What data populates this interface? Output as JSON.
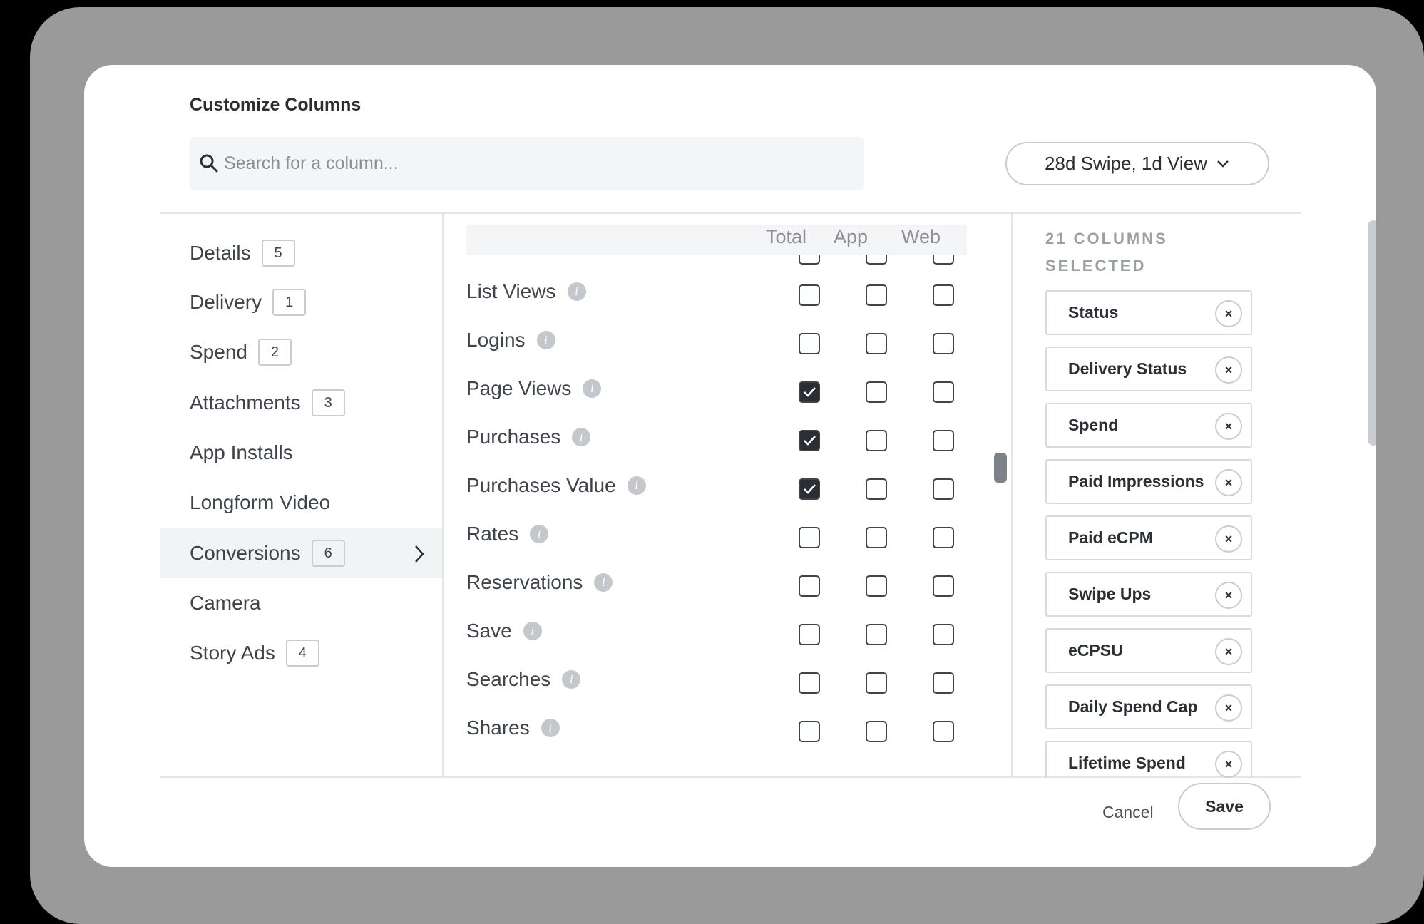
{
  "modal": {
    "title": "Customize Columns",
    "search_placeholder": "Search for a column...",
    "attribution_window": "28d Swipe, 1d View"
  },
  "nav": {
    "items": [
      {
        "label": "Details",
        "count": "5"
      },
      {
        "label": "Delivery",
        "count": "1"
      },
      {
        "label": "Spend",
        "count": "2"
      },
      {
        "label": "Attachments",
        "count": "3"
      },
      {
        "label": "App Installs",
        "count": ""
      },
      {
        "label": "Longform Video",
        "count": ""
      },
      {
        "label": "Conversions",
        "count": "6",
        "active": true
      },
      {
        "label": "Camera",
        "count": ""
      },
      {
        "label": "Story Ads",
        "count": "4"
      }
    ]
  },
  "columns_header": {
    "total": "Total",
    "app": "App",
    "web": "Web"
  },
  "metrics": [
    {
      "label": "List Views",
      "total": false,
      "app": false,
      "web": false
    },
    {
      "label": "Logins",
      "total": false,
      "app": false,
      "web": false
    },
    {
      "label": "Page Views",
      "total": true,
      "app": false,
      "web": false
    },
    {
      "label": "Purchases",
      "total": true,
      "app": false,
      "web": false
    },
    {
      "label": "Purchases Value",
      "total": true,
      "app": false,
      "web": false
    },
    {
      "label": "Rates",
      "total": false,
      "app": false,
      "web": false
    },
    {
      "label": "Reservations",
      "total": false,
      "app": false,
      "web": false
    },
    {
      "label": "Save",
      "total": false,
      "app": false,
      "web": false
    },
    {
      "label": "Searches",
      "total": false,
      "app": false,
      "web": false
    },
    {
      "label": "Shares",
      "total": false,
      "app": false,
      "web": false
    }
  ],
  "selected": {
    "count_label": "21 COLUMNS SELECTED",
    "chips": [
      "Status",
      "Delivery Status",
      "Spend",
      "Paid Impressions",
      "Paid eCPM",
      "Swipe Ups",
      "eCPSU",
      "Daily Spend Cap",
      "Lifetime Spend"
    ]
  },
  "footer": {
    "cancel": "Cancel",
    "save": "Save"
  },
  "icons": {
    "remove": "×"
  },
  "colors": {
    "checkbox_checked": "#2b2f33",
    "modal_bg": "#ffffff",
    "device_bg": "#9a9a9a"
  }
}
